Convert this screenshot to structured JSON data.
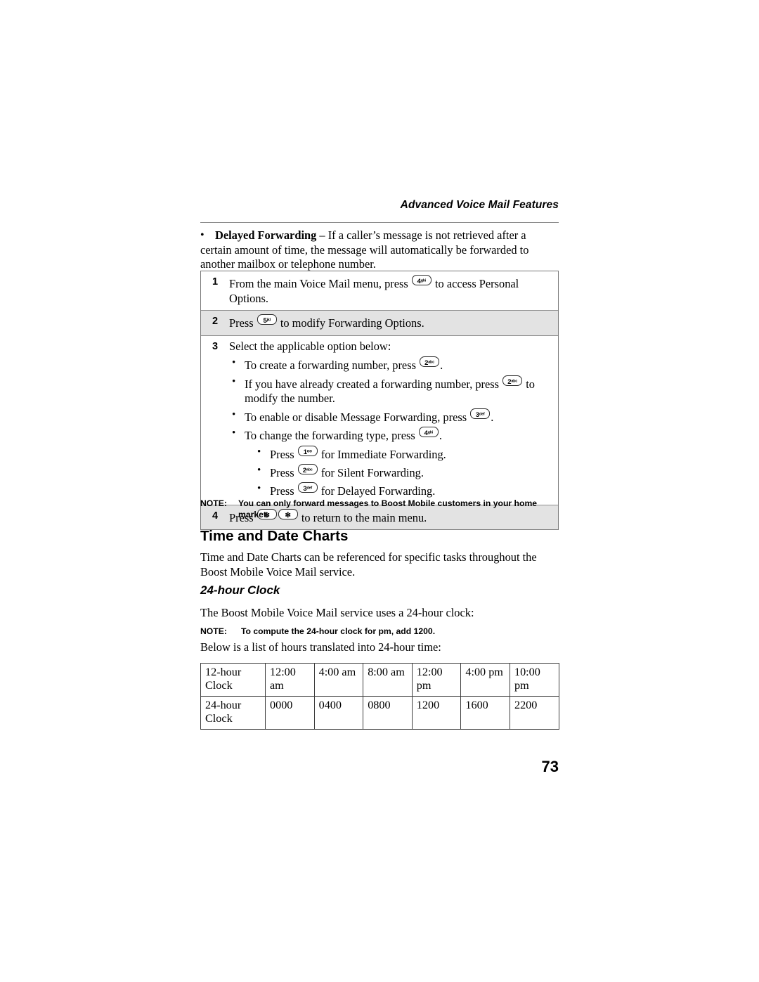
{
  "header": {
    "title": "Advanced Voice Mail Features"
  },
  "intro_bullet": {
    "term": "Delayed Forwarding",
    "text": " – If a caller’s message is not retrieved after a certain amount of time, the message will automatically be forwarded to another mailbox or telephone number."
  },
  "procedure": {
    "steps": [
      {
        "number": "1",
        "text_before": "From the main Voice Mail menu, press ",
        "keys": [
          {
            "digit": "4",
            "letters": "ghi"
          }
        ],
        "text_after": " to access Personal Options.",
        "shaded": false
      },
      {
        "number": "2",
        "text_before": "Press ",
        "keys": [
          {
            "digit": "5",
            "letters": "jkl"
          }
        ],
        "text_after": " to modify Forwarding Options.",
        "shaded": true
      },
      {
        "number": "3",
        "text_before": "Select the applicable option below:",
        "keys": [],
        "text_after": "",
        "shaded": false,
        "sub_items": [
          {
            "text_before": "To create a forwarding number, press ",
            "keys": [
              {
                "digit": "2",
                "letters": "abc"
              }
            ],
            "text_after": "."
          },
          {
            "text_before": "If you have already created a forwarding number, press ",
            "keys": [
              {
                "digit": "2",
                "letters": "abc"
              }
            ],
            "text_after": " to modify the number."
          },
          {
            "text_before": "To enable or disable Message Forwarding, press ",
            "keys": [
              {
                "digit": "3",
                "letters": "def"
              }
            ],
            "text_after": "."
          },
          {
            "text_before": "To change the forwarding type, press ",
            "keys": [
              {
                "digit": "4",
                "letters": "ghi"
              }
            ],
            "text_after": ".",
            "sub_sub_items": [
              {
                "text_before": "Press ",
                "keys": [
                  {
                    "digit": "1",
                    "letters": "oo"
                  }
                ],
                "text_after": " for Immediate Forwarding."
              },
              {
                "text_before": "Press ",
                "keys": [
                  {
                    "digit": "2",
                    "letters": "abc"
                  }
                ],
                "text_after": " for Silent Forwarding."
              },
              {
                "text_before": "Press ",
                "keys": [
                  {
                    "digit": "3",
                    "letters": "def"
                  }
                ],
                "text_after": " for Delayed Forwarding."
              }
            ]
          }
        ]
      },
      {
        "number": "4",
        "text_before": "Press ",
        "keys": [
          {
            "digit": "✻",
            "letters": ""
          },
          {
            "digit": "✻",
            "letters": ""
          }
        ],
        "text_after": " to return to the main menu.",
        "shaded": true
      }
    ]
  },
  "note_1": {
    "label": "NOTE:",
    "text": "You can only forward messages to Boost Mobile customers in your home market."
  },
  "section_heading": "Time and Date Charts",
  "paragraph_1": "Time and Date Charts can be referenced for specific tasks throughout the Boost Mobile Voice Mail service.",
  "sub_heading": "24-hour Clock",
  "paragraph_2": "The Boost Mobile Voice Mail service uses a 24-hour clock:",
  "note_2": {
    "label": "NOTE:",
    "text": "To compute the 24-hour clock for pm, add 1200."
  },
  "paragraph_3": "Below is a list of hours translated into 24-hour time:",
  "clock_table": {
    "rows": [
      {
        "label": "12-hour Clock",
        "values": [
          "12:00 am",
          "4:00 am",
          "8:00 am",
          "12:00 pm",
          "4:00 pm",
          "10:00 pm"
        ]
      },
      {
        "label": "24-hour Clock",
        "values": [
          "0000",
          "0400",
          "0800",
          "1200",
          "1600",
          "2200"
        ]
      }
    ]
  },
  "page_number": "73"
}
